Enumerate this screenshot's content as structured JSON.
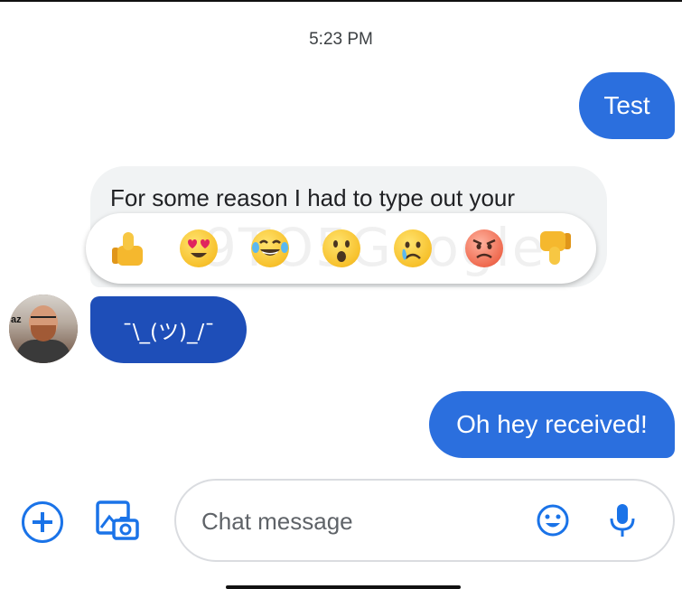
{
  "timestamp": "5:23 PM",
  "messages": {
    "outgoing_1": "Test",
    "incoming_text": "For some reason I had to type out your",
    "incoming_shrug": "¯\\_(ツ)_/¯",
    "outgoing_2": "Oh hey received!"
  },
  "reactions": [
    "thumbs-up",
    "heart-eyes",
    "laughing-tears",
    "surprised",
    "crying",
    "angry",
    "thumbs-down"
  ],
  "watermark": "9TO5Google",
  "avatar_tag": "az",
  "compose": {
    "placeholder": "Chat message"
  },
  "colors": {
    "outgoing_bubble": "#2b6fde",
    "incoming_highlight": "#1e4eb8",
    "incoming_grey": "#f1f3f4",
    "accent": "#1a73e8"
  }
}
